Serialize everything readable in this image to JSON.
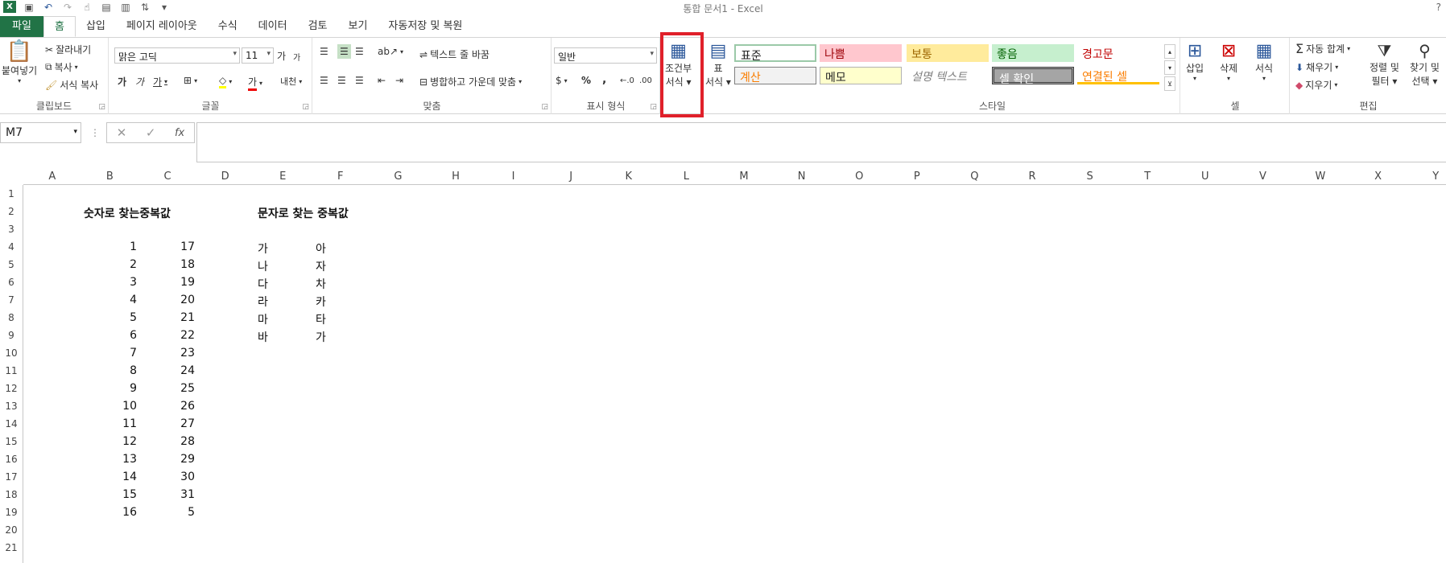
{
  "window": {
    "title": "통합 문서1 - Excel",
    "help": "?"
  },
  "qat": [
    "excel-logo",
    "save-icon",
    "undo-icon",
    "redo-icon",
    "touch-mode-icon",
    "form-icon",
    "print-icon",
    "sort-icon"
  ],
  "tabs": [
    "파일",
    "홈",
    "삽입",
    "페이지 레이아웃",
    "수식",
    "데이터",
    "검토",
    "보기",
    "자동저장 및 복원"
  ],
  "clipboard": {
    "paste": "붙여넣기",
    "cut": "잘라내기",
    "copy": "복사",
    "format_painter": "서식 복사",
    "label": "클립보드"
  },
  "font": {
    "name": "맑은 고딕",
    "size": "11",
    "grow": "가",
    "shrink": "가",
    "bold": "가",
    "italic": "가",
    "underline": "가",
    "font_color": "가",
    "phonetic": "내천",
    "label": "글꼴"
  },
  "alignment": {
    "wrap": "텍스트 줄 바꿈",
    "merge": "병합하고 가운데 맞춤",
    "label": "맞춤"
  },
  "number": {
    "format": "일반",
    "percent": "%",
    "comma": ",",
    "label": "표시 형식"
  },
  "styles_group": {
    "conditional": [
      "조건부",
      "서식"
    ],
    "table": [
      "표",
      "서식"
    ],
    "label": "스타일",
    "cells": [
      "표준",
      "나쁨",
      "보통",
      "좋음",
      "경고문",
      "계산",
      "메모",
      "설명 텍스트",
      "셀 확인",
      "연결된 셀"
    ]
  },
  "cells_group": {
    "insert": "삽입",
    "delete": "삭제",
    "format": "서식",
    "label": "셀"
  },
  "editing": {
    "autosum": "자동 합계",
    "fill": "채우기",
    "clear": "지우기",
    "sort": [
      "정렬 및",
      "필터"
    ],
    "find": [
      "찾기 및",
      "선택"
    ],
    "label": "편집"
  },
  "formula_bar": {
    "name_box": "M7",
    "value": "",
    "fx": "fx"
  },
  "columns": [
    "A",
    "B",
    "C",
    "D",
    "E",
    "F",
    "G",
    "H",
    "I",
    "J",
    "K",
    "L",
    "M",
    "N",
    "O",
    "P",
    "Q",
    "R",
    "S",
    "T",
    "U",
    "V",
    "W",
    "X",
    "Y"
  ],
  "rows": [
    "1",
    "2",
    "3",
    "4",
    "5",
    "6",
    "7",
    "8",
    "9",
    "10",
    "11",
    "12",
    "13",
    "14",
    "15",
    "16",
    "17",
    "18",
    "19",
    "20",
    "21"
  ],
  "sheet": {
    "title_numbers": "숫자로 찾는중복값",
    "title_text": "문자로 찾는 중복값",
    "col_b": [
      "1",
      "2",
      "3",
      "4",
      "5",
      "6",
      "7",
      "8",
      "9",
      "10",
      "11",
      "12",
      "13",
      "14",
      "15",
      "16"
    ],
    "col_c": [
      "17",
      "18",
      "19",
      "20",
      "21",
      "22",
      "23",
      "24",
      "25",
      "26",
      "27",
      "28",
      "29",
      "30",
      "31",
      "5"
    ],
    "col_e": [
      "가",
      "나",
      "다",
      "라",
      "마",
      "바"
    ],
    "col_f": [
      "아",
      "자",
      "차",
      "카",
      "타",
      "가"
    ]
  },
  "colors": {
    "accent": "#217346",
    "highlight": "#e0202a"
  }
}
